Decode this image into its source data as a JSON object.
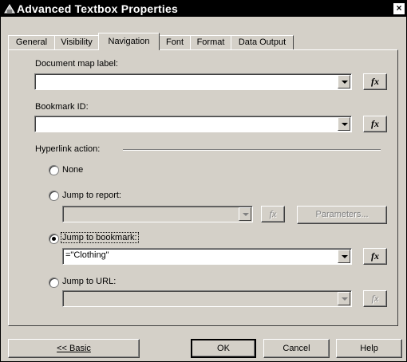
{
  "window": {
    "title": "Advanced Textbox Properties",
    "close_glyph": "×"
  },
  "tabs": [
    {
      "label": "General"
    },
    {
      "label": "Visibility"
    },
    {
      "label": "Navigation",
      "active": true
    },
    {
      "label": "Font"
    },
    {
      "label": "Format"
    },
    {
      "label": "Data Output"
    }
  ],
  "document_map": {
    "label": "Document map label:",
    "value": "",
    "fx_label": "fx"
  },
  "bookmark": {
    "label": "Bookmark ID:",
    "value": "",
    "fx_label": "fx"
  },
  "hyperlink": {
    "section_label": "Hyperlink action:",
    "selected": "jump_to_bookmark",
    "none_label": "None",
    "jump_report_label": "Jump to report:",
    "jump_report_value": "",
    "parameters_label": "Parameters...",
    "jump_bookmark_label": "Jump to bookmark:",
    "jump_bookmark_value": "=\"Clothing\"",
    "jump_url_label": "Jump to URL:",
    "jump_url_value": "",
    "fx_label": "fx"
  },
  "footer": {
    "basic_label": "<< Basic",
    "ok_label": "OK",
    "cancel_label": "Cancel",
    "help_label": "Help"
  }
}
